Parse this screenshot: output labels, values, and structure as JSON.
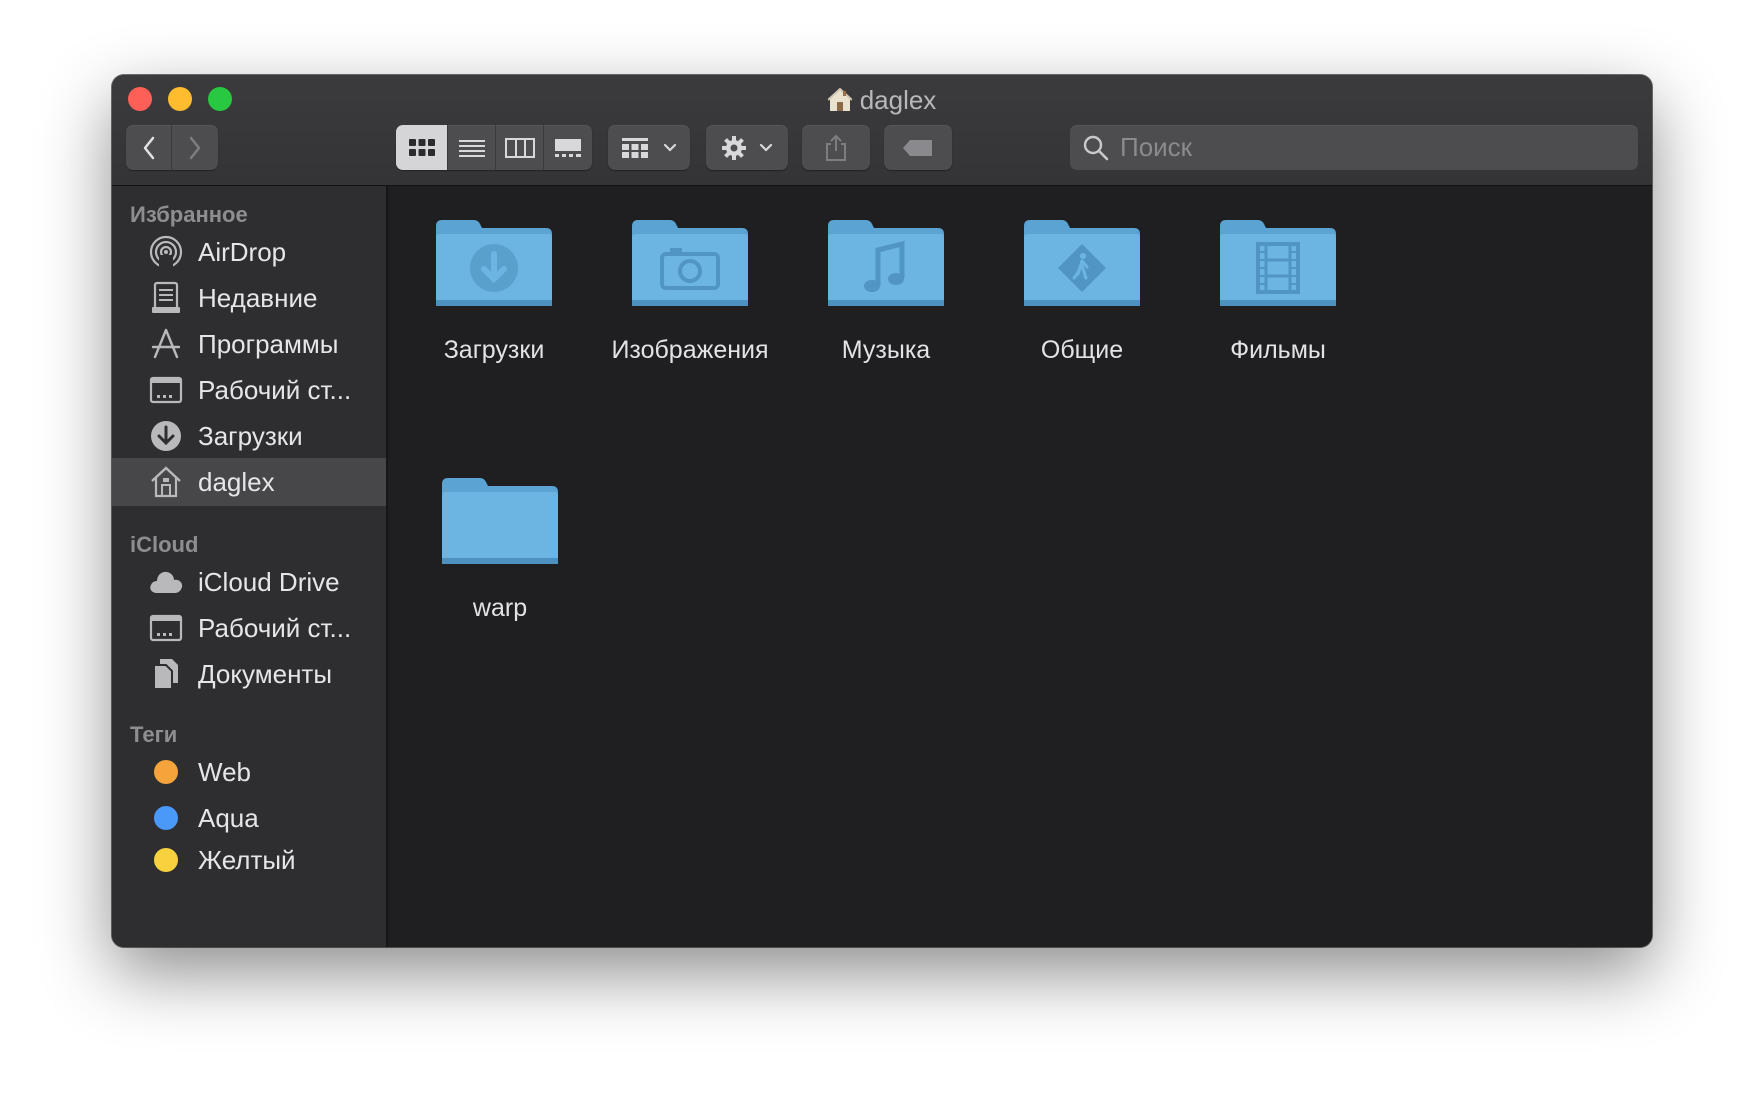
{
  "window": {
    "title": "daglex"
  },
  "toolbar": {
    "nav_back_icon": "chevron-left-icon",
    "nav_forward_icon": "chevron-right-icon",
    "view_modes": [
      "icons",
      "list",
      "columns",
      "gallery"
    ],
    "active_view": "icons"
  },
  "search": {
    "placeholder": "Поиск"
  },
  "sidebar": {
    "sections": {
      "favorites": "Избранное",
      "icloud": "iCloud",
      "tags": "Теги"
    },
    "favorites": [
      {
        "label": "AirDrop",
        "icon": "airdrop-icon"
      },
      {
        "label": "Недавние",
        "icon": "recents-icon"
      },
      {
        "label": "Программы",
        "icon": "applications-icon"
      },
      {
        "label": "Рабочий ст...",
        "icon": "desktop-icon"
      },
      {
        "label": "Загрузки",
        "icon": "downloads-icon"
      },
      {
        "label": "daglex",
        "icon": "home-icon",
        "selected": true
      }
    ],
    "icloud": [
      {
        "label": "iCloud Drive",
        "icon": "cloud-icon"
      },
      {
        "label": "Рабочий ст...",
        "icon": "desktop-icon"
      },
      {
        "label": "Документы",
        "icon": "documents-icon"
      }
    ],
    "tags": [
      {
        "label": "Web",
        "color": "#f5a43c"
      },
      {
        "label": "Aqua",
        "color": "#4a98f7"
      },
      {
        "label": "Желтый",
        "color": "#f7d23e"
      }
    ]
  },
  "files": [
    {
      "name": "Загрузки",
      "icon": "downloads-folder-icon"
    },
    {
      "name": "Изображения",
      "icon": "pictures-folder-icon"
    },
    {
      "name": "Музыка",
      "icon": "music-folder-icon"
    },
    {
      "name": "Общие",
      "icon": "public-folder-icon"
    },
    {
      "name": "Фильмы",
      "icon": "movies-folder-icon"
    },
    {
      "name": "warp",
      "icon": "folder-icon"
    }
  ],
  "colors": {
    "folder_top": "#5aa3d3",
    "folder_body": "#6cb5e2",
    "sidebar_bg": "#2e2e30",
    "content_bg": "#1f1f21"
  }
}
